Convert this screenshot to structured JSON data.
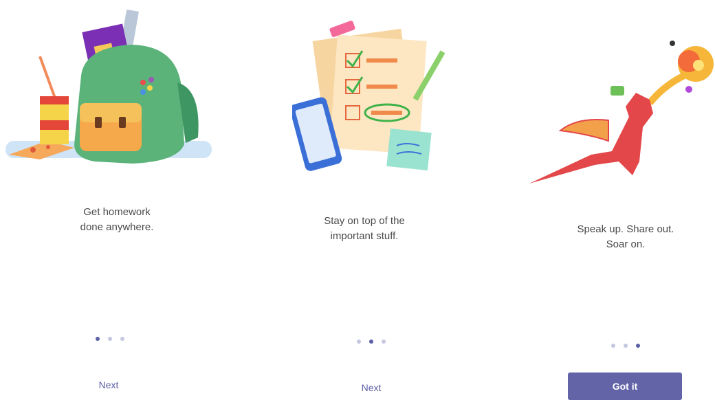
{
  "slides": [
    {
      "caption": "Get homework\ndone anywhere.",
      "button": "Next",
      "illustration": "backpack-illustration"
    },
    {
      "caption": "Stay on top of the\nimportant stuff.",
      "button": "Next",
      "illustration": "checklist-illustration"
    },
    {
      "caption": "Speak up. Share out.\nSoar on.",
      "button": "Got it",
      "illustration": "dragon-illustration"
    }
  ],
  "pager": {
    "total": 3
  },
  "colors": {
    "accent": "#6264a7",
    "dot_active": "#5b5fa6",
    "dot_inactive": "#c5c6e0",
    "caption_text": "#4a4a4a"
  }
}
